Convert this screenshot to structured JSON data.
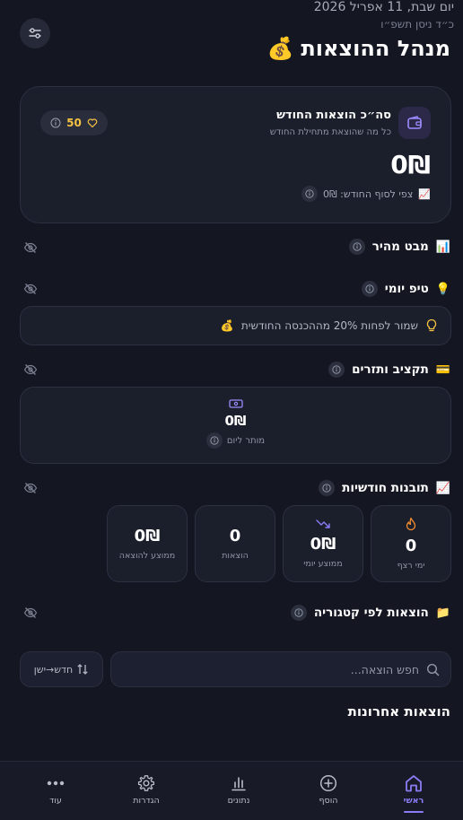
{
  "header": {
    "date": "יום שבת, 11 אפריל 2026",
    "hebrew_date": "כ״ד ניסן תשפ״ו",
    "title": "מנהל ההוצאות",
    "title_emoji": "💰"
  },
  "summary": {
    "title": "סה״כ הוצאות החודש",
    "subtitle": "כל מה שהוצאת מתחילת החודש",
    "amount": "0₪",
    "points": "50",
    "forecast_emoji": "📈",
    "forecast": "צפי לסוף החודש: 0₪"
  },
  "sections": {
    "quick_view": {
      "emoji": "📊",
      "label": "מבט מהיר"
    },
    "daily_tip": {
      "emoji": "💡",
      "label": "טיפ יומי"
    },
    "budget": {
      "emoji": "💳",
      "label": "תקציב ותזרים"
    },
    "monthly": {
      "emoji": "📈",
      "label": "תובנות חודשיות"
    },
    "by_category": {
      "emoji": "📁",
      "label": "הוצאות לפי קטגוריה"
    }
  },
  "tip": {
    "text": "שמור לפחות 20% מההכנסה החודשית",
    "emoji": "💰"
  },
  "budget": {
    "amount": "0₪",
    "label": "מותר ליום"
  },
  "stats": [
    {
      "value": "0",
      "label": "ימי רצף",
      "icon": "flame-icon"
    },
    {
      "value": "0₪",
      "label": "ממוצע יומי",
      "icon": "trend-down-icon"
    },
    {
      "value": "0",
      "label": "הוצאות",
      "icon": ""
    },
    {
      "value": "0₪",
      "label": "ממוצע להוצאה",
      "icon": ""
    }
  ],
  "search": {
    "placeholder": "חפש הוצאה..."
  },
  "sort": {
    "label": "חדש→ישן"
  },
  "recent": {
    "title": "הוצאות אחרונות"
  },
  "nav": [
    {
      "label": "ראשי",
      "icon": "home-icon",
      "active": true
    },
    {
      "label": "הוסף",
      "icon": "plus-circle-icon",
      "active": false
    },
    {
      "label": "נתונים",
      "icon": "bar-chart-icon",
      "active": false
    },
    {
      "label": "הגדרות",
      "icon": "gear-icon",
      "active": false
    },
    {
      "label": "עוד",
      "icon": "more-icon",
      "active": false
    }
  ],
  "colors": {
    "background": "#141622",
    "card": "#1b1e2b",
    "accent": "#8b7cf6",
    "gold": "#f5c242",
    "flame": "#f28b30"
  }
}
